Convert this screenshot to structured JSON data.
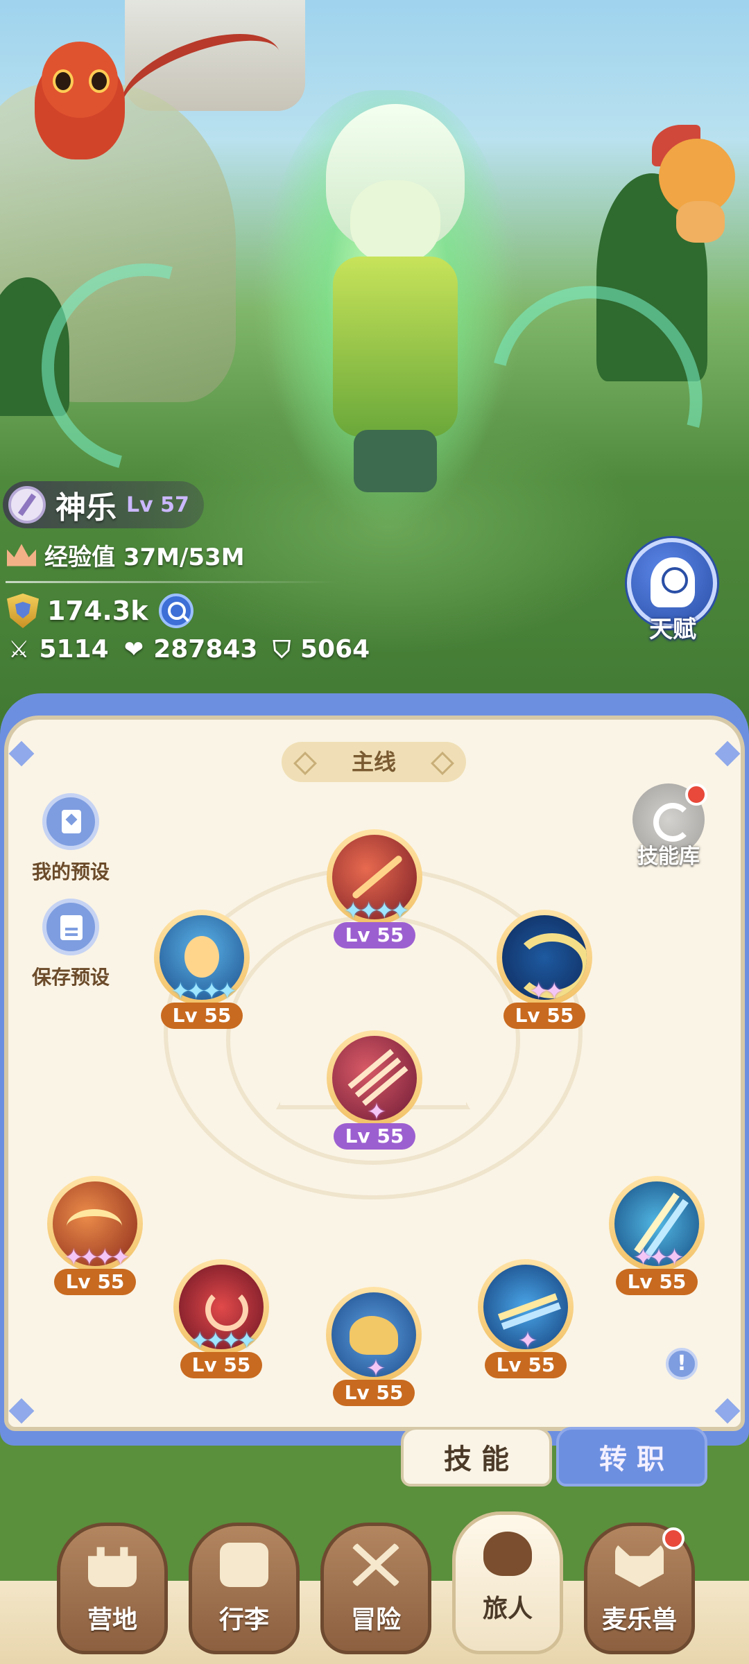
{
  "player": {
    "name": "神乐",
    "level": "Lv 57",
    "exp_label": "经验值 37M/53M",
    "power": "174.3k",
    "attack": "5114",
    "hp": "287843",
    "defense": "5064"
  },
  "talent_button": {
    "label": "天赋"
  },
  "panel": {
    "header": "主线",
    "my_presets": "我的预设",
    "save_preset": "保存预设",
    "skill_library": "技能库",
    "info": "!"
  },
  "skills": [
    {
      "icon": "crescent-slash-icon",
      "level": "Lv 55",
      "stars": "✦✦✦✦",
      "star_color": "blue",
      "badge": "purple"
    },
    {
      "icon": "radiant-hero-icon",
      "level": "Lv 55",
      "stars": "✦✦✦✦",
      "star_color": "blue",
      "badge": "orange"
    },
    {
      "icon": "golden-swirl-icon",
      "level": "Lv 55",
      "stars": "✦✦",
      "star_color": "pink",
      "badge": "orange"
    },
    {
      "icon": "triple-arrow-icon",
      "level": "Lv 55",
      "stars": "✦",
      "star_color": "pink",
      "badge": "purple"
    },
    {
      "icon": "fire-storm-icon",
      "level": "Lv 55",
      "stars": "✦✦✦✦",
      "star_color": "pink",
      "badge": "orange"
    },
    {
      "icon": "fire-ring-icon",
      "level": "Lv 55",
      "stars": "✦✦✦✦",
      "star_color": "blue",
      "badge": "orange"
    },
    {
      "icon": "spirit-wolf-icon",
      "level": "Lv 55",
      "stars": "✦",
      "star_color": "pink",
      "badge": "orange"
    },
    {
      "icon": "lightning-arrow-icon",
      "level": "Lv 55",
      "stars": "✦",
      "star_color": "pink",
      "badge": "orange"
    },
    {
      "icon": "ice-burst-icon",
      "level": "Lv 55",
      "stars": "✦✦✦",
      "star_color": "pink",
      "badge": "orange"
    }
  ],
  "tabs": {
    "skill": "技 能",
    "job_change": "转 职"
  },
  "nav": [
    {
      "label": "营地",
      "icon": "castle-icon"
    },
    {
      "label": "行李",
      "icon": "backpack-icon"
    },
    {
      "label": "冒险",
      "icon": "crossed-swords-icon"
    },
    {
      "label": "旅人",
      "icon": "traveler-icon"
    },
    {
      "label": "麦乐兽",
      "icon": "pet-fox-icon"
    }
  ],
  "colors": {
    "panel_bg": "#faf4e6",
    "panel_frame": "#6d8fe0",
    "level_badge_orange": "#c86a1f",
    "level_badge_purple": "#9c5fd0",
    "notification_red": "#e8493a"
  }
}
